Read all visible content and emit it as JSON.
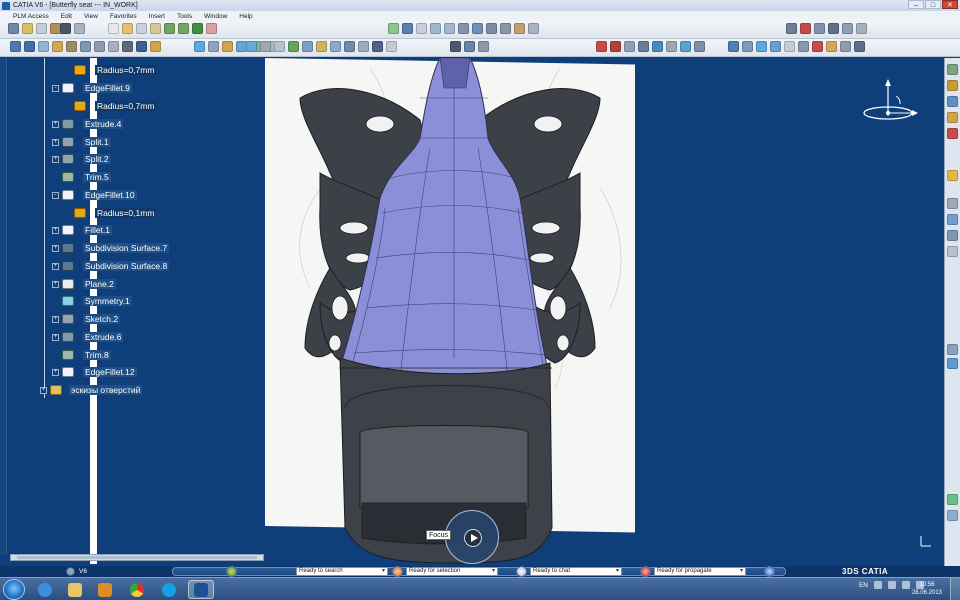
{
  "window": {
    "title": "CATIA V6 - [Butterfly seat --- IN_WORK]",
    "controls": [
      "–",
      "□",
      "✕"
    ]
  },
  "menu": [
    "PLM Access",
    "Edit",
    "View",
    "Favorites",
    "Insert",
    "Tools",
    "Window",
    "Help"
  ],
  "tree": {
    "items": [
      {
        "label": "Radius=0,7mm",
        "type": "param"
      },
      {
        "label": "EdgeFillet.9",
        "type": "fillet"
      },
      {
        "label": "Radius=0,7mm",
        "type": "param"
      },
      {
        "label": "Extrude.4",
        "type": "extrude"
      },
      {
        "label": "Split.1",
        "type": "split"
      },
      {
        "label": "Split.2",
        "type": "split"
      },
      {
        "label": "Trim.5",
        "type": "trim"
      },
      {
        "label": "EdgeFillet.10",
        "type": "fillet"
      },
      {
        "label": "Radius=0,1mm",
        "type": "param"
      },
      {
        "label": "Fillet.1",
        "type": "fillet"
      },
      {
        "label": "Subdivision Surface.7",
        "type": "subdiv"
      },
      {
        "label": "Subdivision Surface.8",
        "type": "subdiv"
      },
      {
        "label": "Plane.2",
        "type": "plane"
      },
      {
        "label": "Symmetry.1",
        "type": "sym"
      },
      {
        "label": "Sketch.2",
        "type": "sketch"
      },
      {
        "label": "Extrude.6",
        "type": "extrude"
      },
      {
        "label": "Trim.8",
        "type": "trim"
      },
      {
        "label": "EdgeFillet.12",
        "type": "fillet"
      },
      {
        "label": "эскизы отверстий",
        "type": "folder"
      }
    ]
  },
  "viewport": {
    "focus_label": "Focus"
  },
  "status": {
    "v6_label": "V6",
    "search": "Ready to search",
    "selection": "Ready for selection",
    "chat": "Ready to chat",
    "propagate": "Ready for propagate",
    "brand": "3DS CATIA"
  },
  "taskbar": {
    "apps": [
      "internet-explorer",
      "explorer",
      "media-player",
      "chrome",
      "skype",
      "catia"
    ],
    "lang": "EN",
    "time": "10:56",
    "date": "28.06.2013"
  },
  "colors": {
    "viewport_bg": "#0f3f7a",
    "model_body": "#8b8fd8",
    "model_dark": "#3d4148",
    "accent": "#e6a91a"
  }
}
